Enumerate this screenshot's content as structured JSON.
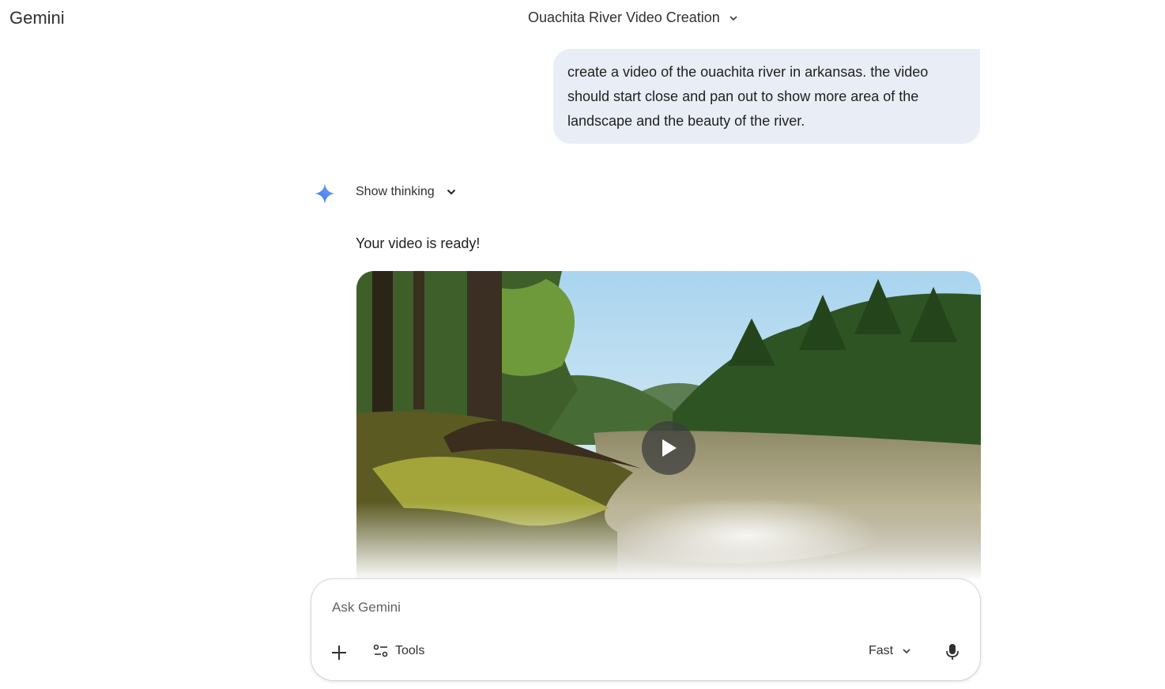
{
  "app": {
    "name": "Gemini"
  },
  "header": {
    "conversation_title": "Ouachita River Video Creation",
    "title_chevron_icon": "chevron-down-icon"
  },
  "conversation": {
    "user_message": "create a video of the ouachita river in arkansas. the video should start close and pan out to show more area of the landscape and the beauty of the river.",
    "response": {
      "thinking_label": "Show thinking",
      "text": "Your video is ready!",
      "video": {
        "subject": "forest river landscape",
        "play_icon": "play-icon"
      }
    }
  },
  "composer": {
    "placeholder": "Ask Gemini",
    "tools_label": "Tools",
    "model_label": "Fast",
    "icons": [
      "plus-icon",
      "tools-icon",
      "chevron-down-icon",
      "microphone-icon"
    ]
  },
  "colors": {
    "accent": "#4c8df6",
    "bubble": "#e9eef6"
  }
}
